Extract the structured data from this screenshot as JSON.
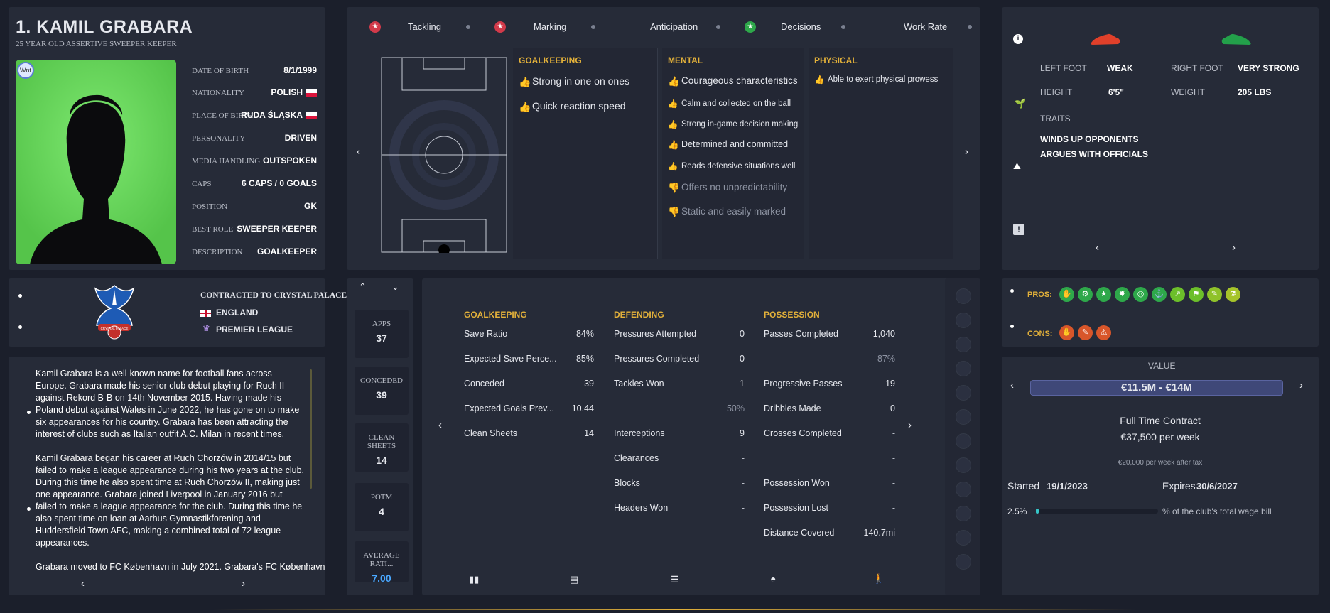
{
  "profile": {
    "name": "1. KAMIL GRABARA",
    "subtitle": "25 YEAR OLD ASSERTIVE SWEEPER KEEPER",
    "badge": "Wnt",
    "rows": [
      {
        "label": "DATE OF BIRTH",
        "value": "8/1/1999"
      },
      {
        "label": "NATIONALITY",
        "value": "POLISH"
      },
      {
        "label": "PLACE OF BIRTH",
        "value": "RUDA ŚLĄSKA"
      },
      {
        "label": "PERSONALITY",
        "value": "DRIVEN"
      },
      {
        "label": "MEDIA HANDLING",
        "value": "OUTSPOKEN"
      },
      {
        "label": "CAPS",
        "value": "6 CAPS / 0 GOALS"
      },
      {
        "label": "POSITION",
        "value": "GK"
      },
      {
        "label": "BEST ROLE",
        "value": "SWEEPER KEEPER"
      },
      {
        "label": "DESCRIPTION",
        "value": "GOALKEEPER"
      }
    ]
  },
  "attributes": {
    "tabs": [
      "Tackling",
      "Marking",
      "Anticipation",
      "Decisions",
      "Work Rate"
    ],
    "goalkeeping": {
      "title": "GOALKEEPING",
      "items": [
        "Strong in one on ones",
        "Quick reaction speed"
      ]
    },
    "mental": {
      "title": "MENTAL",
      "positive": [
        "Courageous characteristics",
        "Calm and collected on the ball",
        "Strong in-game decision making",
        "Determined and committed",
        "Reads defensive situations well"
      ],
      "negative": [
        "Offers no unpredictability",
        "Static and easily marked"
      ]
    },
    "physical": {
      "title": "PHYSICAL",
      "items": [
        "Able to exert physical prowess"
      ]
    }
  },
  "physical": {
    "left_foot_label": "LEFT FOOT",
    "left_foot": "WEAK",
    "right_foot_label": "RIGHT FOOT",
    "right_foot": "VERY STRONG",
    "height_label": "HEIGHT",
    "height": "6'5\"",
    "weight_label": "WEIGHT",
    "weight": "205 LBS",
    "traits_label": "TRAITS",
    "traits": [
      "WINDS UP OPPONENTS",
      "ARGUES WITH OFFICIALS"
    ]
  },
  "club": {
    "contract": "CONTRACTED TO CRYSTAL PALACE",
    "country": "ENGLAND",
    "league": "PREMIER LEAGUE",
    "crest_text": "CRYSTAL PALACE"
  },
  "bio": {
    "p1": "Kamil Grabara is a well-known name for football fans across Europe. Grabara made his senior club debut playing for Ruch II against Rekord B-B on 14th November 2015. Having made his Poland debut against Wales in June 2022, he has gone on to make six appearances for his country. Grabara has been attracting the interest of clubs such as Italian outfit A.C. Milan in recent times.",
    "p2": "Kamil Grabara began his career at Ruch Chorzów in 2014/15 but failed to make a league appearance during his two years at the club. During this time he also spent time at Ruch Chorzów II, making just one appearance. Grabara joined Liverpool in January 2016 but failed to make a league appearance for the club. During this time he also spent time on loan at Aarhus Gymnastikforening and Huddersfield Town AFC, making a combined total of 72 league appearances.",
    "p3": "Grabara moved to FC København in July 2021. Grabara's FC København"
  },
  "season_stats": [
    {
      "label": "APPS",
      "value": "37"
    },
    {
      "label": "CONCEDED",
      "value": "39"
    },
    {
      "label": "CLEAN SHEETS",
      "value": "14"
    },
    {
      "label": "POTM",
      "value": "4"
    },
    {
      "label": "AVERAGE RATI...",
      "value": "7.00"
    }
  ],
  "stats": {
    "goalkeeping": {
      "title": "GOALKEEPING",
      "rows": [
        {
          "k": "Save Ratio",
          "v": "84%"
        },
        {
          "k": "Expected Save Perce...",
          "v": "85%"
        },
        {
          "k": "Conceded",
          "v": "39"
        },
        {
          "k": "Expected Goals Prev...",
          "v": "10.44"
        },
        {
          "k": "Clean Sheets",
          "v": "14"
        }
      ]
    },
    "defending": {
      "title": "DEFENDING",
      "rows": [
        {
          "k": "Pressures Attempted",
          "v": "0"
        },
        {
          "k": "Pressures Completed",
          "v": "0"
        },
        {
          "k": "Tackles Won",
          "v": "1"
        },
        {
          "k": "",
          "v": "50%"
        },
        {
          "k": "Interceptions",
          "v": "9"
        },
        {
          "k": "Clearances",
          "v": "-"
        },
        {
          "k": "Blocks",
          "v": "-"
        },
        {
          "k": "Headers Won",
          "v": "-"
        },
        {
          "k": "",
          "v": "-"
        }
      ]
    },
    "possession": {
      "title": "POSSESSION",
      "rows": [
        {
          "k": "Passes Completed",
          "v": "1,040"
        },
        {
          "k": "",
          "v": "87%"
        },
        {
          "k": "Progressive Passes",
          "v": "19"
        },
        {
          "k": "Dribbles Made",
          "v": "0"
        },
        {
          "k": "Crosses Completed",
          "v": "-"
        },
        {
          "k": "",
          "v": "-"
        },
        {
          "k": "Possession Won",
          "v": "-"
        },
        {
          "k": "Possession Lost",
          "v": "-"
        },
        {
          "k": "Distance Covered",
          "v": "140.7mi"
        }
      ]
    }
  },
  "pros_cons": {
    "pros_label": "PROS:",
    "cons_label": "CONS:"
  },
  "contract": {
    "value_label": "VALUE",
    "value": "€11.5M - €14M",
    "type": "Full Time Contract",
    "wage": "€37,500 per week",
    "after_tax": "€20,000 per week after tax",
    "started_label": "Started",
    "started": "19/1/2023",
    "expires_label": "Expires",
    "expires": "30/6/2027",
    "wage_pct": "2.5%",
    "wage_pct_fraction": 0.025,
    "wage_bill_text": "% of the club's total wage bill"
  },
  "colors": {
    "accent": "#e3b13a",
    "panel": "#262b38",
    "bg": "#1b1f2b",
    "value_bar": "#3f4878"
  }
}
